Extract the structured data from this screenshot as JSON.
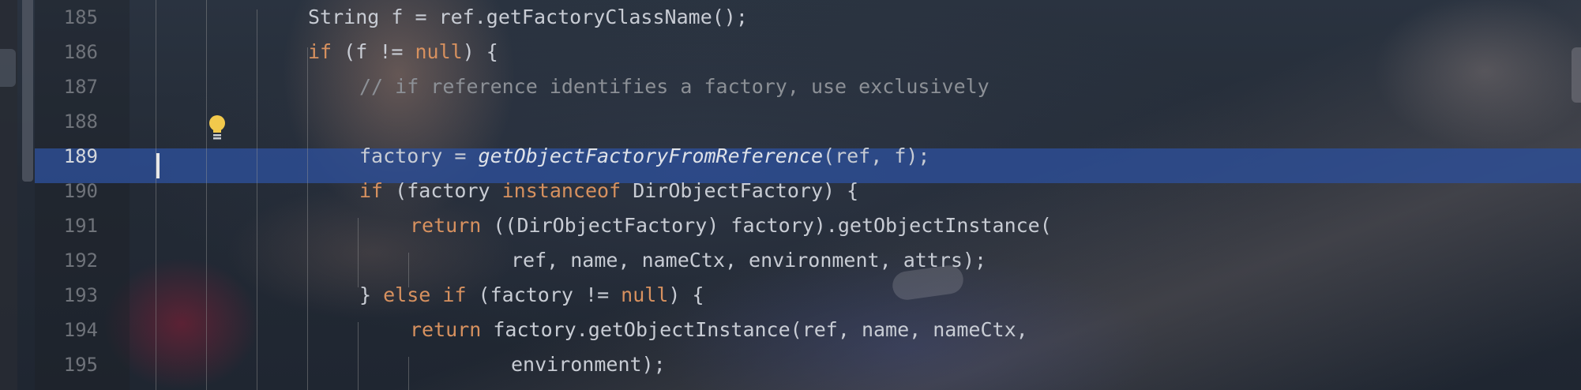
{
  "editor": {
    "colors": {
      "keyword": "#d7915f",
      "comment": "#8c9096",
      "text": "#c8ccd4",
      "line_number": "#6f737a",
      "current_line_number": "#d5d8dd",
      "current_line_highlight": "#2d4e96"
    },
    "current_line": "189",
    "gutter_icon": "lightbulb-icon",
    "lines": [
      {
        "number": "185",
        "tokens": [
          {
            "t": "String f = ref.getFactoryClassName();",
            "k": "plain"
          }
        ]
      },
      {
        "number": "186",
        "tokens": [
          {
            "t": "if",
            "k": "kw"
          },
          {
            "t": " (f != ",
            "k": "plain"
          },
          {
            "t": "null",
            "k": "kw"
          },
          {
            "t": ") {",
            "k": "plain"
          }
        ]
      },
      {
        "number": "187",
        "tokens": [
          {
            "t": "// if reference identifies a factory, use exclusively",
            "k": "cm"
          }
        ]
      },
      {
        "number": "188",
        "tokens": []
      },
      {
        "number": "189",
        "tokens": [
          {
            "t": "factory = ",
            "k": "plain"
          },
          {
            "t": "getObjectFactoryFromReference",
            "k": "it"
          },
          {
            "t": "(ref, f);",
            "k": "plain"
          }
        ]
      },
      {
        "number": "190",
        "tokens": [
          {
            "t": "if",
            "k": "kw"
          },
          {
            "t": " (factory ",
            "k": "plain"
          },
          {
            "t": "instanceof",
            "k": "kw"
          },
          {
            "t": " DirObjectFactory) {",
            "k": "plain"
          }
        ]
      },
      {
        "number": "191",
        "tokens": [
          {
            "t": "return",
            "k": "kw"
          },
          {
            "t": " ((DirObjectFactory) factory).getObjectInstance(",
            "k": "plain"
          }
        ]
      },
      {
        "number": "192",
        "tokens": [
          {
            "t": "ref, name, nameCtx, environment, attrs);",
            "k": "plain"
          }
        ]
      },
      {
        "number": "193",
        "tokens": [
          {
            "t": "} ",
            "k": "plain"
          },
          {
            "t": "else",
            "k": "kw"
          },
          {
            "t": " ",
            "k": "plain"
          },
          {
            "t": "if",
            "k": "kw"
          },
          {
            "t": " (factory != ",
            "k": "plain"
          },
          {
            "t": "null",
            "k": "kw"
          },
          {
            "t": ") {",
            "k": "plain"
          }
        ]
      },
      {
        "number": "194",
        "tokens": [
          {
            "t": "return",
            "k": "kw"
          },
          {
            "t": " factory.getObjectInstance(ref, name, nameCtx,",
            "k": "plain"
          }
        ]
      },
      {
        "number": "195",
        "tokens": [
          {
            "t": "environment);",
            "k": "plain"
          }
        ]
      }
    ]
  }
}
